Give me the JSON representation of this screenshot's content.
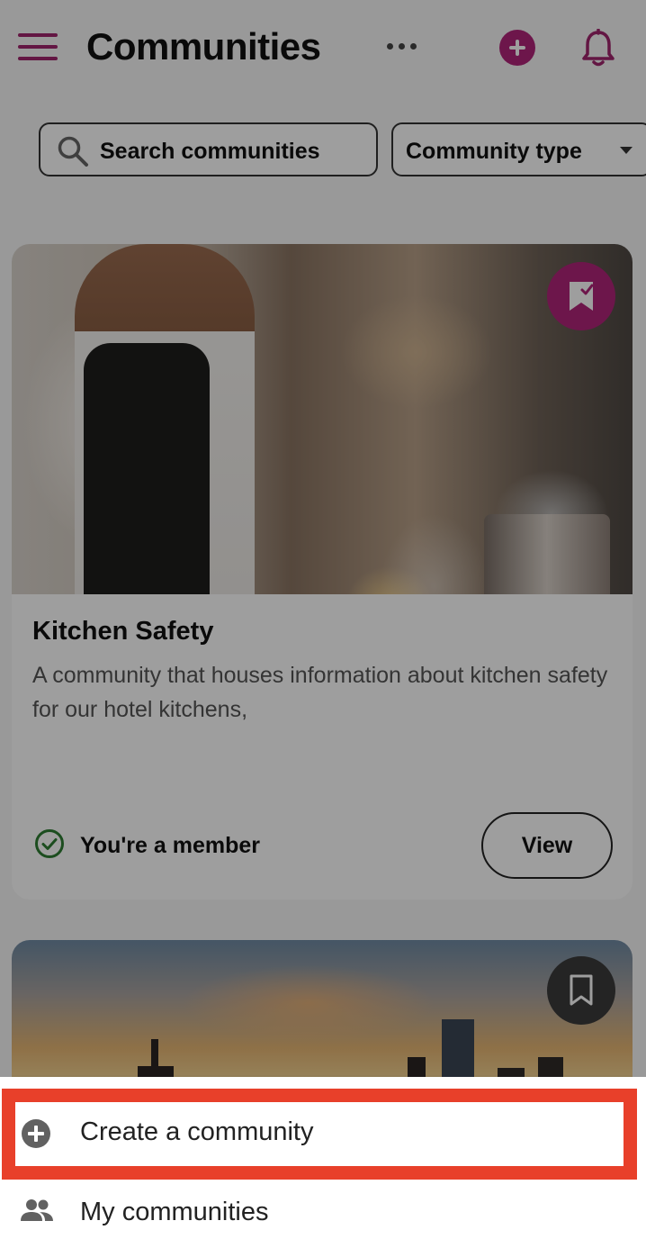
{
  "header": {
    "title": "Communities"
  },
  "filters": {
    "search_label": "Search communities",
    "type_label": "Community type"
  },
  "cards": [
    {
      "title": "Kitchen Safety",
      "description": "A community that houses information about kitchen safety for our hotel kitchens,",
      "membership": "You're a member",
      "action": "View",
      "bookmarked": true
    },
    {
      "bookmarked": false
    }
  ],
  "sheet": {
    "items": [
      {
        "label": "Create a community",
        "icon": "add-circle-icon"
      },
      {
        "label": "My communities",
        "icon": "people-icon"
      }
    ]
  },
  "colors": {
    "brand": "#b0247a",
    "highlight": "#e8402a",
    "member_check": "#2e7d32"
  }
}
